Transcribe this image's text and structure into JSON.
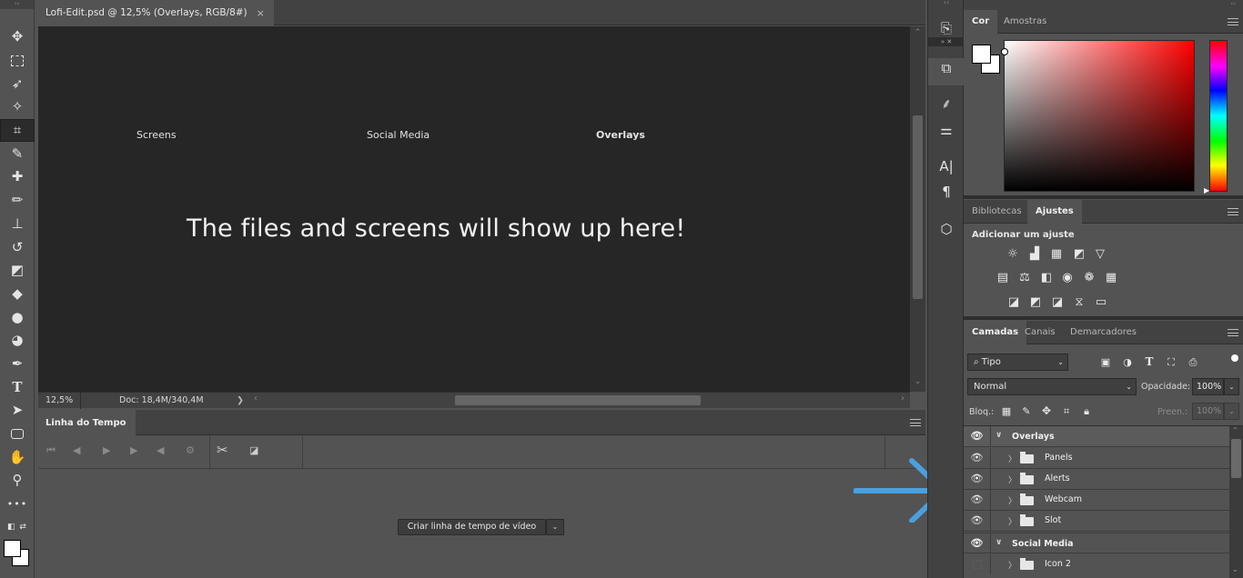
{
  "document": {
    "tab_title": "Lofi-Edit.psd @ 12,5% (Overlays, RGB/8#)",
    "close_glyph": "×",
    "nav": [
      "Screens",
      "Social Media",
      "Overlays"
    ],
    "hero_text": "The files and screens will show up here!",
    "zoom": "12,5%",
    "doc_info": "Doc: 18,4M/340,4M"
  },
  "toolbar": {
    "tools": [
      "move-tool",
      "marquee-tool",
      "lasso-tool",
      "magic-wand-tool",
      "crop-tool",
      "eyedropper-tool",
      "healing-brush-tool",
      "brush-tool",
      "stamp-tool",
      "history-brush-tool",
      "eraser-tool",
      "paint-bucket-tool",
      "blur-tool",
      "dodge-tool",
      "pen-tool",
      "type-tool",
      "path-selection-tool",
      "shape-tool",
      "hand-tool",
      "zoom-tool",
      "more-tools"
    ]
  },
  "timeline": {
    "tab": "Linha do Tempo",
    "create_button": "Criar linha de tempo de vídeo"
  },
  "color_panel": {
    "tabs": [
      "Cor",
      "Amostras"
    ],
    "foreground": "#ffffff",
    "background": "#ffffff"
  },
  "adjust_panel": {
    "tabs": [
      "Bibliotecas",
      "Ajustes"
    ],
    "title": "Adicionar um ajuste"
  },
  "layers_panel": {
    "tabs": [
      "Camadas",
      "Canais",
      "Demarcadores"
    ],
    "filter": "Tipo",
    "blend_mode": "Normal",
    "opacity_label": "Opacidade:",
    "opacity": "100%",
    "lock_label": "Bloq.:",
    "fill_label": "Preen.:",
    "fill": "100%",
    "layers": [
      {
        "name": "Overlays",
        "type": "group-open",
        "visible": true
      },
      {
        "name": "Panels",
        "type": "group",
        "visible": true
      },
      {
        "name": "Alerts",
        "type": "group",
        "visible": true
      },
      {
        "name": "Webcam",
        "type": "group",
        "visible": true
      },
      {
        "name": "Slot",
        "type": "group",
        "visible": true
      },
      {
        "name": "Social Media",
        "type": "group-open",
        "visible": true
      },
      {
        "name": "Icon 2",
        "type": "group",
        "visible": false
      }
    ]
  },
  "colors": {
    "accent_arrow": "#4a9fe0"
  }
}
